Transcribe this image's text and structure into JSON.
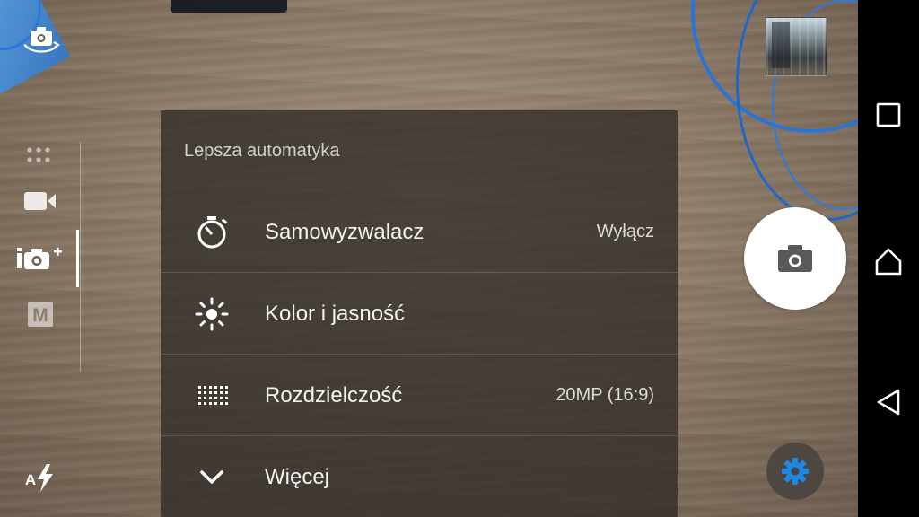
{
  "menu": {
    "header": "Lepsza automatyka",
    "items": [
      {
        "label": "Samowyzwalacz",
        "value": "Wyłącz",
        "icon": "self-timer-icon"
      },
      {
        "label": "Kolor i jasność",
        "value": "",
        "icon": "brightness-icon"
      },
      {
        "label": "Rozdzielczość",
        "value": "20MP (16:9)",
        "icon": "resolution-grid-icon"
      },
      {
        "label": "Więcej",
        "value": "",
        "icon": "chevron-down-icon"
      }
    ]
  },
  "modes": [
    {
      "name": "apps",
      "icon": "apps-dots-icon"
    },
    {
      "name": "video",
      "icon": "video-camera-icon"
    },
    {
      "name": "superior-auto",
      "icon": "superior-auto-icon",
      "selected": true
    },
    {
      "name": "manual",
      "icon": "manual-mode-icon",
      "badge": "M"
    }
  ],
  "left_top_icon": "switch-camera-icon",
  "flash": {
    "icon": "auto-flash-icon",
    "badge": "A"
  },
  "shutter_icon": "camera-icon",
  "settings_icon": "gear-icon",
  "nav": {
    "icons": [
      "recent-apps-icon",
      "home-icon",
      "back-icon"
    ]
  },
  "colors": {
    "accent": "#1e88e5",
    "panel": "#302c28",
    "text": "#f3f2f0"
  }
}
